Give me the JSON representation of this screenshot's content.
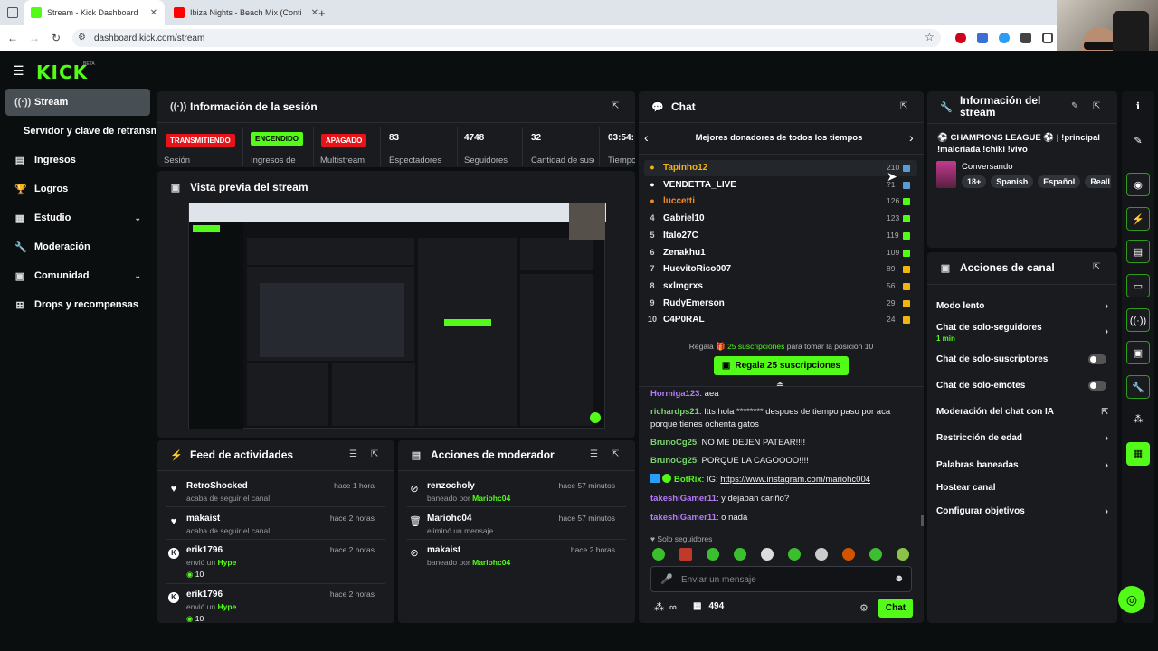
{
  "browser": {
    "tabs": [
      {
        "title": "Stream - Kick Dashboard",
        "close": "✕"
      },
      {
        "title": "Ibiza Nights - Beach Mix (Conti",
        "close": "✕"
      }
    ],
    "new_tab": "+",
    "url": "dashboard.kick.com/stream"
  },
  "kick": {
    "logo": "KICK",
    "beta": "BETA"
  },
  "sidebar": {
    "items": [
      {
        "label": "Stream",
        "icon": "broadcast-icon"
      },
      {
        "label": "Servidor y clave de retransmisión",
        "icon": ""
      },
      {
        "label": "Ingresos",
        "icon": "dollar-icon"
      },
      {
        "label": "Logros",
        "icon": "trophy-icon"
      },
      {
        "label": "Estudio",
        "icon": "studio-icon"
      },
      {
        "label": "Moderación",
        "icon": "wrench-icon"
      },
      {
        "label": "Comunidad",
        "icon": "community-icon"
      },
      {
        "label": "Drops y recompensas",
        "icon": "drops-icon"
      }
    ]
  },
  "session": {
    "title": "Información de la sesión",
    "stats": [
      {
        "value": "TRANSMITIENDO",
        "label": "Sesión",
        "color": "#e5141a"
      },
      {
        "value": "ENCENDIDO",
        "label": "Ingresos de",
        "color": "#53fc18"
      },
      {
        "value": "APAGADO",
        "label": "Multistream",
        "color": "#e5141a"
      },
      {
        "value": "83",
        "label": "Espectadores"
      },
      {
        "value": "4748",
        "label": "Seguidores"
      },
      {
        "value": "32",
        "label": "Cantidad de suscripciones"
      },
      {
        "value": "03:54:",
        "label": "Tiempo en vivo"
      }
    ]
  },
  "preview": {
    "title": "Vista previa del stream"
  },
  "feed": {
    "title": "Feed de actividades",
    "items": [
      {
        "name": "RetroShocked",
        "sub": "acaba de seguir el canal",
        "time": "hace 1 hora",
        "icon": "heart-icon"
      },
      {
        "name": "makaist",
        "sub": "acaba de seguir el canal",
        "time": "hace 2 horas",
        "icon": "heart-icon"
      },
      {
        "name": "erik1796",
        "sub": "envió un",
        "hype": "Hype",
        "amount": "10",
        "time": "hace 2 horas",
        "icon": "kick-icon"
      },
      {
        "name": "erik1796",
        "sub": "envió un",
        "hype": "Hype",
        "amount": "10",
        "time": "hace 2 horas",
        "icon": "kick-icon"
      }
    ]
  },
  "modactions": {
    "title": "Acciones de moderador",
    "items": [
      {
        "name": "renzocholy",
        "sub": "baneado por",
        "by": "Mariohc04",
        "time": "hace 57 minutos",
        "icon": "ban-icon"
      },
      {
        "name": "Mariohc04",
        "sub": "eliminó un mensaje",
        "by": "",
        "time": "hace 57 minutos",
        "icon": "trash-icon"
      },
      {
        "name": "makaist",
        "sub": "baneado por",
        "by": "Mariohc04",
        "time": "hace 2 horas",
        "icon": "ban-icon"
      }
    ]
  },
  "chat": {
    "title": "Chat",
    "leaderboard_title": "Mejores donadores de todos los tiempos",
    "donors": [
      {
        "rank": "1",
        "name": "Tapinho12",
        "value": "210",
        "color": "#f2b40f"
      },
      {
        "rank": "2",
        "name": "VENDETTA_LIVE",
        "value": "?1",
        "color": "#ffffff"
      },
      {
        "rank": "3",
        "name": "luccetti",
        "value": "126",
        "color": "#f28a2a"
      },
      {
        "rank": "4",
        "name": "Gabriel10",
        "value": "123",
        "color": "#ffffff"
      },
      {
        "rank": "5",
        "name": "Italo27C",
        "value": "119",
        "color": "#ffffff"
      },
      {
        "rank": "6",
        "name": "Zenakhu1",
        "value": "109",
        "color": "#ffffff"
      },
      {
        "rank": "7",
        "name": "HuevitoRico007",
        "value": "89",
        "color": "#ffffff"
      },
      {
        "rank": "8",
        "name": "sxlmgrxs",
        "value": "56",
        "color": "#ffffff"
      },
      {
        "rank": "9",
        "name": "RudyEmerson",
        "value": "29",
        "color": "#ffffff"
      },
      {
        "rank": "10",
        "name": "C4P0RAL",
        "value": "24",
        "color": "#ffffff"
      }
    ],
    "gift_prompt_pre": "Regala",
    "gift_prompt_subs": "25 suscripciones",
    "gift_prompt_post": "para tomar la posición 10",
    "gift_button": "Regala 25 suscripciones",
    "messages": [
      {
        "user": "Hormiga123",
        "text": ": aea",
        "color": "#b67bf7"
      },
      {
        "user": "richardps21",
        "text": ": Itts hola ******** despues de tiempo paso por aca porque tienes ochenta gatos",
        "color": "#7bd36d"
      },
      {
        "user": "BrunoCg25",
        "text": ": NO ME DEJEN PATEAR!!!!",
        "color": "#7bd36d"
      },
      {
        "user": "BrunoCg25",
        "text": ": PORQUE LA CAGOOOO!!!!",
        "color": "#7bd36d"
      },
      {
        "user": "BotRix",
        "text": ": IG: ",
        "link": "https://www.instagram.com/mariohc004",
        "color": "#53fc18"
      },
      {
        "user": "takeshiGamer11",
        "text": ": y dejaban cariño?",
        "color": "#b67bf7"
      },
      {
        "user": "takeshiGamer11",
        "text": ": o nada",
        "color": "#b67bf7"
      }
    ],
    "mode": "Solo seguidores",
    "input_placeholder": "Enviar un mensaje",
    "viewer_count": "494",
    "infinity": "∞",
    "send_button": "Chat"
  },
  "stream_info": {
    "title": "Información del stream",
    "stream_title": "⚽ CHAMPIONS LEAGUE ⚽ | !principal !malcriada !chiki !vivo",
    "category": "Conversando",
    "tags": [
      "18+",
      "Spanish",
      "Español",
      "Reall"
    ]
  },
  "channel_actions": {
    "title": "Acciones de canal",
    "items": [
      {
        "label": "Modo lento",
        "control": "chevron"
      },
      {
        "label": "Chat de solo-seguidores",
        "sub": "1 min",
        "control": "chevron"
      },
      {
        "label": "Chat de solo-suscriptores",
        "control": "toggle"
      },
      {
        "label": "Chat de solo-emotes",
        "control": "toggle"
      },
      {
        "label": "Moderación del chat con IA",
        "control": "external"
      },
      {
        "label": "Restricción de edad",
        "control": "chevron"
      },
      {
        "label": "Palabras baneadas",
        "control": "chevron"
      },
      {
        "label": "Hostear canal",
        "control": "none"
      },
      {
        "label": "Configurar objetivos",
        "control": "chevron"
      }
    ]
  },
  "colors": {
    "accent": "#53fc18",
    "panel": "#191b1f",
    "bg": "#0b0e0f",
    "live_red": "#e5141a"
  }
}
